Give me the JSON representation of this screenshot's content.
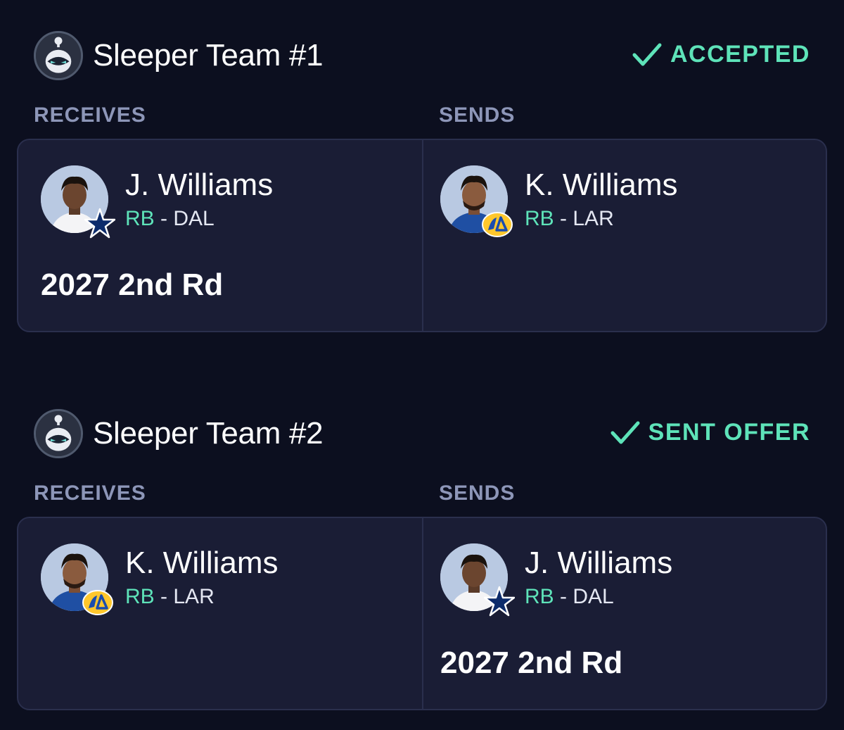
{
  "colors": {
    "background": "#0c0f1f",
    "card": "#1a1d35",
    "accent": "#5ee3b9",
    "label": "#8d96b8"
  },
  "trades": [
    {
      "team_name": "Sleeper Team #1",
      "avatar_icon": "sleeper-mascot-icon",
      "status": {
        "icon": "check-icon",
        "label": "ACCEPTED"
      },
      "receives_label": "RECEIVES",
      "sends_label": "SENDS",
      "receives": {
        "player": {
          "name": "J. Williams",
          "position": "RB",
          "separator": "-",
          "team": "DAL",
          "team_icon": "dallas-star-icon"
        },
        "pick": "2027 2nd Rd"
      },
      "sends": {
        "player": {
          "name": "K. Williams",
          "position": "RB",
          "separator": "-",
          "team": "LAR",
          "team_icon": "rams-logo-icon"
        }
      }
    },
    {
      "team_name": "Sleeper Team #2",
      "avatar_icon": "sleeper-mascot-icon",
      "status": {
        "icon": "check-icon",
        "label": "SENT OFFER"
      },
      "receives_label": "RECEIVES",
      "sends_label": "SENDS",
      "receives": {
        "player": {
          "name": "K. Williams",
          "position": "RB",
          "separator": "-",
          "team": "LAR",
          "team_icon": "rams-logo-icon"
        }
      },
      "sends": {
        "player": {
          "name": "J. Williams",
          "position": "RB",
          "separator": "-",
          "team": "DAL",
          "team_icon": "dallas-star-icon"
        },
        "pick": "2027 2nd Rd"
      }
    }
  ]
}
